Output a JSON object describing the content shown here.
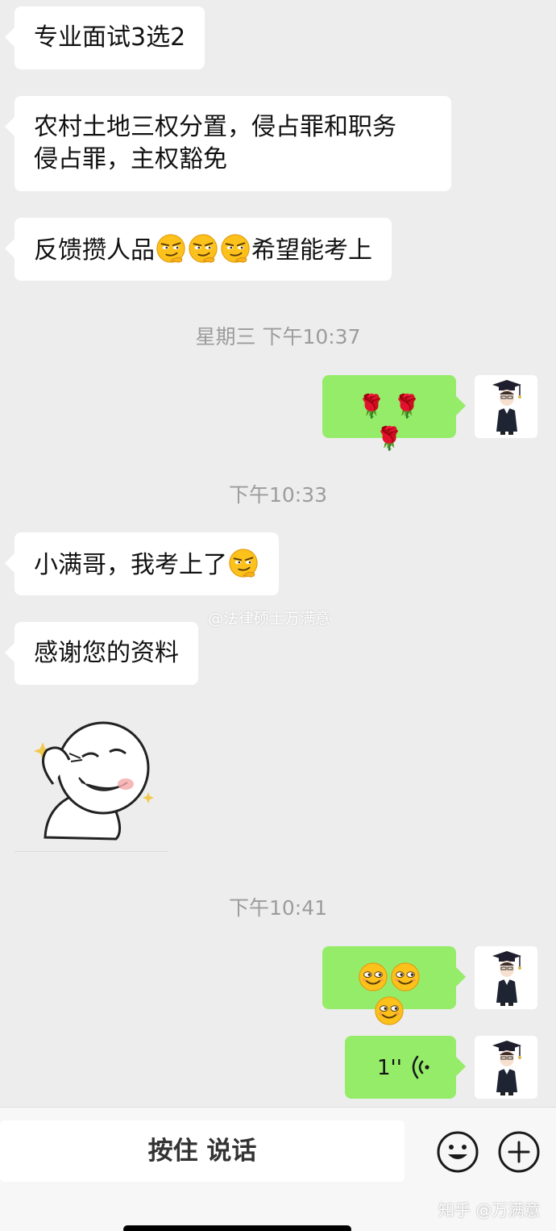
{
  "messages": {
    "m1": "专业面试3选2",
    "m2_line1": "农村土地三权分置，侵占罪和职务",
    "m2_line2": "侵占罪，主权豁免",
    "m3_a": "反馈攒人品",
    "m3_b": "希望能考上",
    "time1": "星期三 下午10:37",
    "rose": "🌹",
    "time2": "下午10:33",
    "m5": "小满哥，我考上了",
    "m6": "感谢您的资料",
    "time3": "下午10:41",
    "voice_duration": "1''"
  },
  "icons": {
    "smirk": "smirk-emoji",
    "grin": "grin-emoji",
    "voice": "voice-wave-icon",
    "avatar": "graduate-avatar",
    "sticker": "laughing-face-sticker",
    "emoji_button": "emoji-face-icon",
    "plus_button": "plus-circle-icon"
  },
  "watermark": "@法律硕士万满意",
  "inputbar": {
    "hold_to_talk": "按住 说话"
  },
  "footer_watermark": "知乎 @万满意",
  "colors": {
    "background": "#ededed",
    "incoming_bubble": "#ffffff",
    "outgoing_bubble": "#95ec69",
    "timestamp": "#9c9c9c"
  }
}
